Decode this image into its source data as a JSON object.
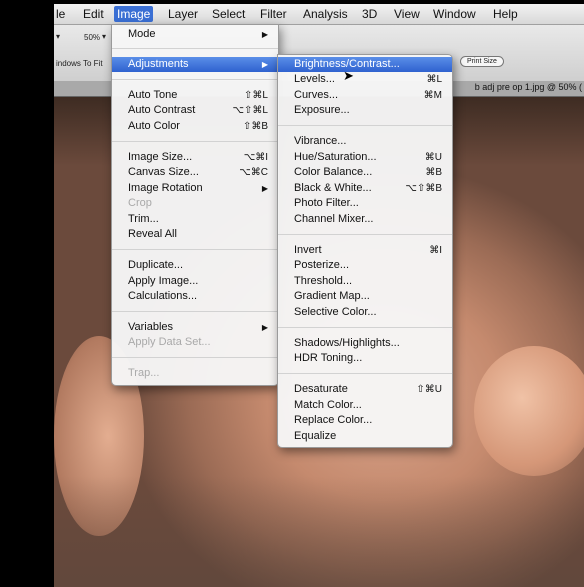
{
  "menubar": {
    "items": [
      "le",
      "Edit",
      "Image",
      "Layer",
      "Select",
      "Filter",
      "Analysis",
      "3D",
      "View",
      "Window",
      "Help"
    ],
    "active": "Image"
  },
  "options": {
    "zoom": "50%",
    "fit_button": "indows To Fit",
    "print_size": "Print Size"
  },
  "document_tab": "b adj pre op 1.jpg @ 50% (",
  "image_menu": {
    "mode": "Mode",
    "adjustments": "Adjustments",
    "auto_tone": "Auto Tone",
    "auto_tone_sc": "⇧⌘L",
    "auto_contrast": "Auto Contrast",
    "auto_contrast_sc": "⌥⇧⌘L",
    "auto_color": "Auto Color",
    "auto_color_sc": "⇧⌘B",
    "image_size": "Image Size...",
    "image_size_sc": "⌥⌘I",
    "canvas_size": "Canvas Size...",
    "canvas_size_sc": "⌥⌘C",
    "image_rotation": "Image Rotation",
    "crop": "Crop",
    "trim": "Trim...",
    "reveal_all": "Reveal All",
    "duplicate": "Duplicate...",
    "apply_image": "Apply Image...",
    "calculations": "Calculations...",
    "variables": "Variables",
    "apply_data_set": "Apply Data Set...",
    "trap": "Trap..."
  },
  "adjust_menu": {
    "brightness": "Brightness/Contrast...",
    "levels": "Levels...",
    "levels_sc": "⌘L",
    "curves": "Curves...",
    "curves_sc": "⌘M",
    "exposure": "Exposure...",
    "vibrance": "Vibrance...",
    "hue_sat": "Hue/Saturation...",
    "hue_sat_sc": "⌘U",
    "color_balance": "Color Balance...",
    "color_balance_sc": "⌘B",
    "bw": "Black & White...",
    "bw_sc": "⌥⇧⌘B",
    "photo_filter": "Photo Filter...",
    "channel_mixer": "Channel Mixer...",
    "invert": "Invert",
    "invert_sc": "⌘I",
    "posterize": "Posterize...",
    "threshold": "Threshold...",
    "gradient_map": "Gradient Map...",
    "selective_color": "Selective Color...",
    "shadows": "Shadows/Highlights...",
    "hdr": "HDR Toning...",
    "desaturate": "Desaturate",
    "desaturate_sc": "⇧⌘U",
    "match_color": "Match Color...",
    "replace_color": "Replace Color...",
    "equalize": "Equalize"
  }
}
